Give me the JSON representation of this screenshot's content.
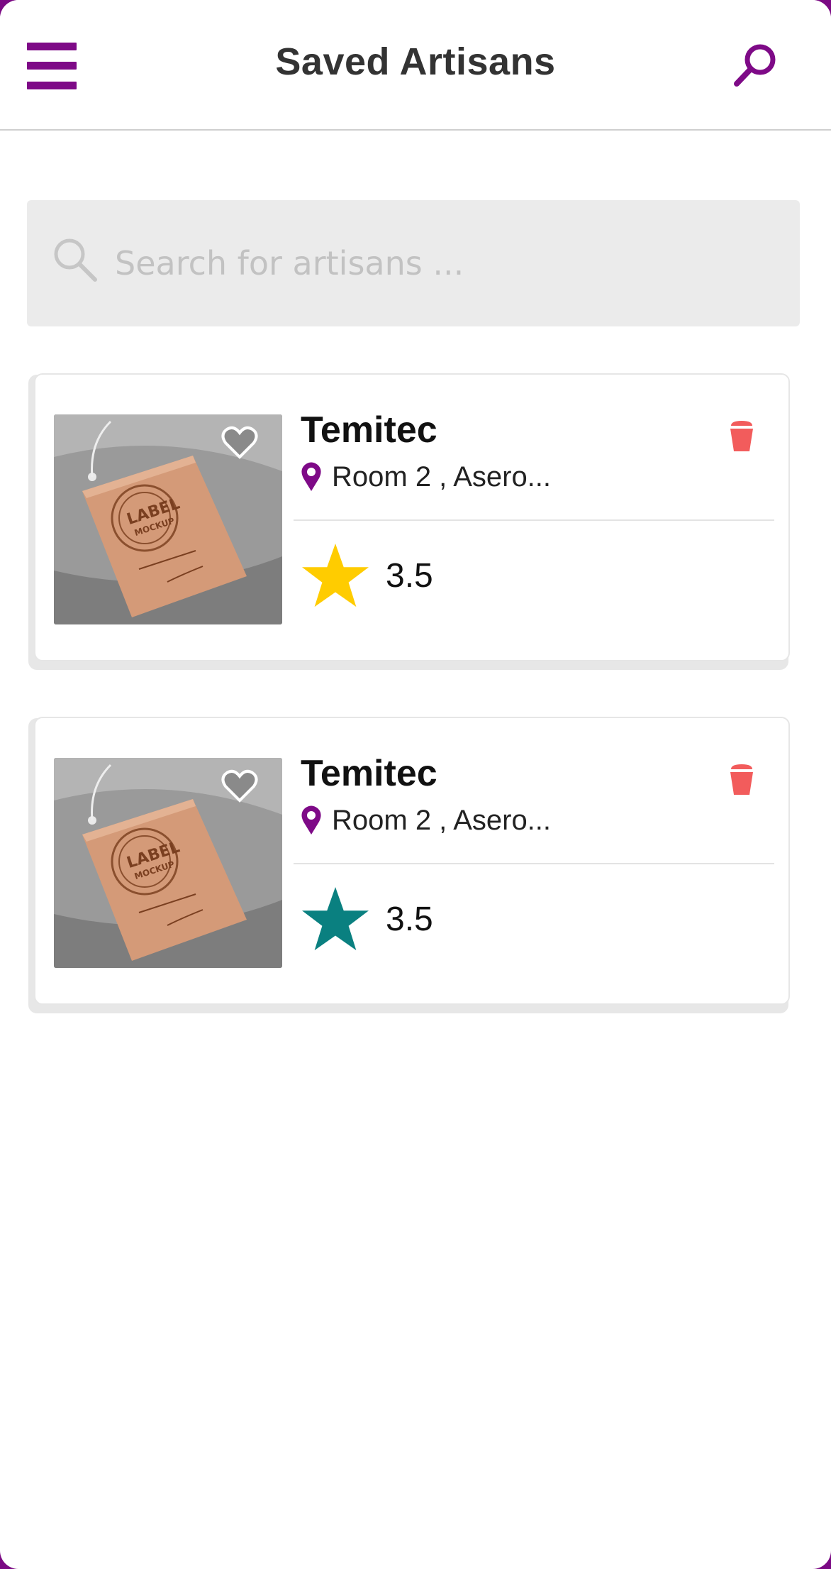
{
  "header": {
    "title": "Saved Artisans",
    "menu_icon": "hamburger-menu-icon",
    "search_icon": "search-icon"
  },
  "search": {
    "placeholder": "Search for artisans ...",
    "value": ""
  },
  "artisans": [
    {
      "name": "Temitec",
      "location": "Room 2 , Asero...",
      "rating": "3.5",
      "star_color": "#ffcc00",
      "image": "label-mockup-tag-photo"
    },
    {
      "name": "Temitec",
      "location": "Room 2 , Asero...",
      "rating": "3.5",
      "star_color": "#0a8080",
      "image": "label-mockup-tag-photo"
    }
  ],
  "colors": {
    "brand": "#7e0a87",
    "delete": "#f25c5c",
    "title": "#333333",
    "search_bg": "#ebebeb"
  }
}
